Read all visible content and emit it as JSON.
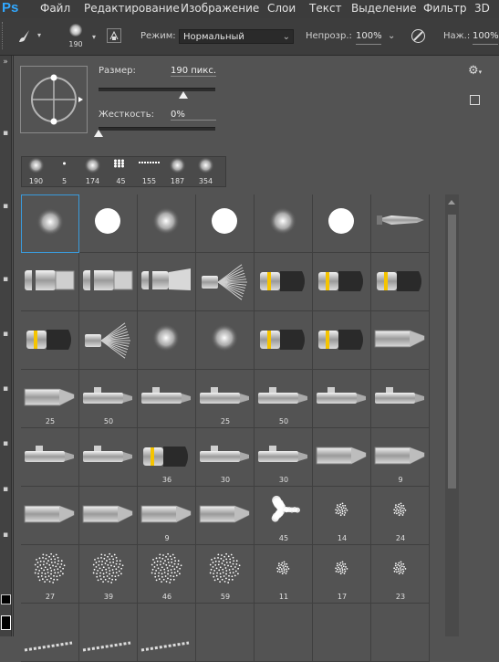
{
  "app": {
    "logo": "Ps"
  },
  "menu": {
    "items": [
      "Файл",
      "Редактирование",
      "Изображение",
      "Слои",
      "Текст",
      "Выделение",
      "Фильтр",
      "3D"
    ]
  },
  "options": {
    "brush_size_value": "190",
    "mode_label": "Режим:",
    "mode_value": "Нормальный",
    "opacity_label": "Непрозр.:",
    "opacity_value": "100%",
    "pressure_label": "Наж.:",
    "pressure_value": "100%"
  },
  "brush_panel": {
    "size_label": "Размер:",
    "size_value": "190 пикс.",
    "size_fraction": 0.73,
    "hardness_label": "Жесткость:",
    "hardness_value": "0%",
    "hardness_fraction": 0.0
  },
  "recent_brushes": [
    {
      "size": "190",
      "kind": "soft"
    },
    {
      "size": "5",
      "kind": "dot"
    },
    {
      "size": "174",
      "kind": "soft"
    },
    {
      "size": "45",
      "kind": "scatter"
    },
    {
      "size": "155",
      "kind": "line"
    },
    {
      "size": "187",
      "kind": "soft"
    },
    {
      "size": "354",
      "kind": "soft"
    }
  ],
  "presets": [
    {
      "kind": "soft",
      "label": "",
      "selected": true
    },
    {
      "kind": "hard",
      "label": ""
    },
    {
      "kind": "soft",
      "label": ""
    },
    {
      "kind": "hard",
      "label": ""
    },
    {
      "kind": "soft",
      "label": ""
    },
    {
      "kind": "hard",
      "label": ""
    },
    {
      "kind": "tip",
      "label": ""
    },
    {
      "kind": "flat",
      "label": ""
    },
    {
      "kind": "flat",
      "label": ""
    },
    {
      "kind": "flat-angled",
      "label": ""
    },
    {
      "kind": "fan",
      "label": ""
    },
    {
      "kind": "round-dark",
      "label": ""
    },
    {
      "kind": "round-dark",
      "label": ""
    },
    {
      "kind": "round-dark",
      "label": ""
    },
    {
      "kind": "round-dark",
      "label": ""
    },
    {
      "kind": "fan",
      "label": ""
    },
    {
      "kind": "soft",
      "label": ""
    },
    {
      "kind": "soft",
      "label": ""
    },
    {
      "kind": "round-dark",
      "label": ""
    },
    {
      "kind": "round-dark",
      "label": ""
    },
    {
      "kind": "pencil",
      "label": ""
    },
    {
      "kind": "pencil",
      "label": "25"
    },
    {
      "kind": "marker",
      "label": "50"
    },
    {
      "kind": "marker",
      "label": ""
    },
    {
      "kind": "marker",
      "label": "25"
    },
    {
      "kind": "marker",
      "label": "50"
    },
    {
      "kind": "marker",
      "label": ""
    },
    {
      "kind": "marker",
      "label": ""
    },
    {
      "kind": "marker",
      "label": ""
    },
    {
      "kind": "marker",
      "label": ""
    },
    {
      "kind": "round-dark",
      "label": "36"
    },
    {
      "kind": "marker",
      "label": "30"
    },
    {
      "kind": "marker",
      "label": "30"
    },
    {
      "kind": "pencil",
      "label": ""
    },
    {
      "kind": "pencil",
      "label": "9"
    },
    {
      "kind": "pencil",
      "label": ""
    },
    {
      "kind": "pencil",
      "label": ""
    },
    {
      "kind": "pencil",
      "label": "9"
    },
    {
      "kind": "pencil",
      "label": ""
    },
    {
      "kind": "splatter",
      "label": "45"
    },
    {
      "kind": "spray-small",
      "label": "14"
    },
    {
      "kind": "spray-small",
      "label": "24"
    },
    {
      "kind": "spray",
      "label": "27"
    },
    {
      "kind": "spray",
      "label": "39"
    },
    {
      "kind": "spray",
      "label": "46"
    },
    {
      "kind": "spray",
      "label": "59"
    },
    {
      "kind": "spray-small",
      "label": "11"
    },
    {
      "kind": "spray-small",
      "label": "17"
    },
    {
      "kind": "spray-small",
      "label": "23"
    },
    {
      "kind": "streak",
      "label": ""
    },
    {
      "kind": "streak",
      "label": ""
    },
    {
      "kind": "streak",
      "label": ""
    },
    {
      "kind": "empty",
      "label": ""
    },
    {
      "kind": "empty",
      "label": ""
    },
    {
      "kind": "empty",
      "label": ""
    },
    {
      "kind": "empty",
      "label": ""
    }
  ]
}
